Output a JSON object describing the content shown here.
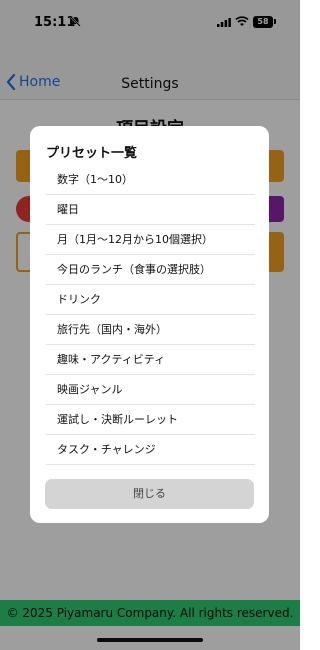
{
  "status_bar": {
    "time": "15:11",
    "battery": "58"
  },
  "nav": {
    "back_label": "Home",
    "title": "Settings"
  },
  "page": {
    "heading": "項目設定"
  },
  "modal": {
    "title": "プリセット一覧",
    "items": [
      {
        "label": "数字（1〜10）"
      },
      {
        "label": "曜日"
      },
      {
        "label": "月（1月〜12月から10個選択）"
      },
      {
        "label": "今日のランチ（食事の選択肢）"
      },
      {
        "label": "ドリンク"
      },
      {
        "label": "旅行先（国内・海外）"
      },
      {
        "label": "趣味・アクティビティ"
      },
      {
        "label": "映画ジャンル"
      },
      {
        "label": "運試し・決断ルーレット"
      },
      {
        "label": "タスク・チャレンジ"
      }
    ],
    "close_label": "閉じる"
  },
  "footer": {
    "text": "© 2025 Piyamaru Company. All rights reserved."
  },
  "colors": {
    "accent": "#1a73e8",
    "footer_bg": "#2ecc71",
    "orange": "#f0a020",
    "red": "#e53935",
    "purple": "#8e24aa"
  }
}
